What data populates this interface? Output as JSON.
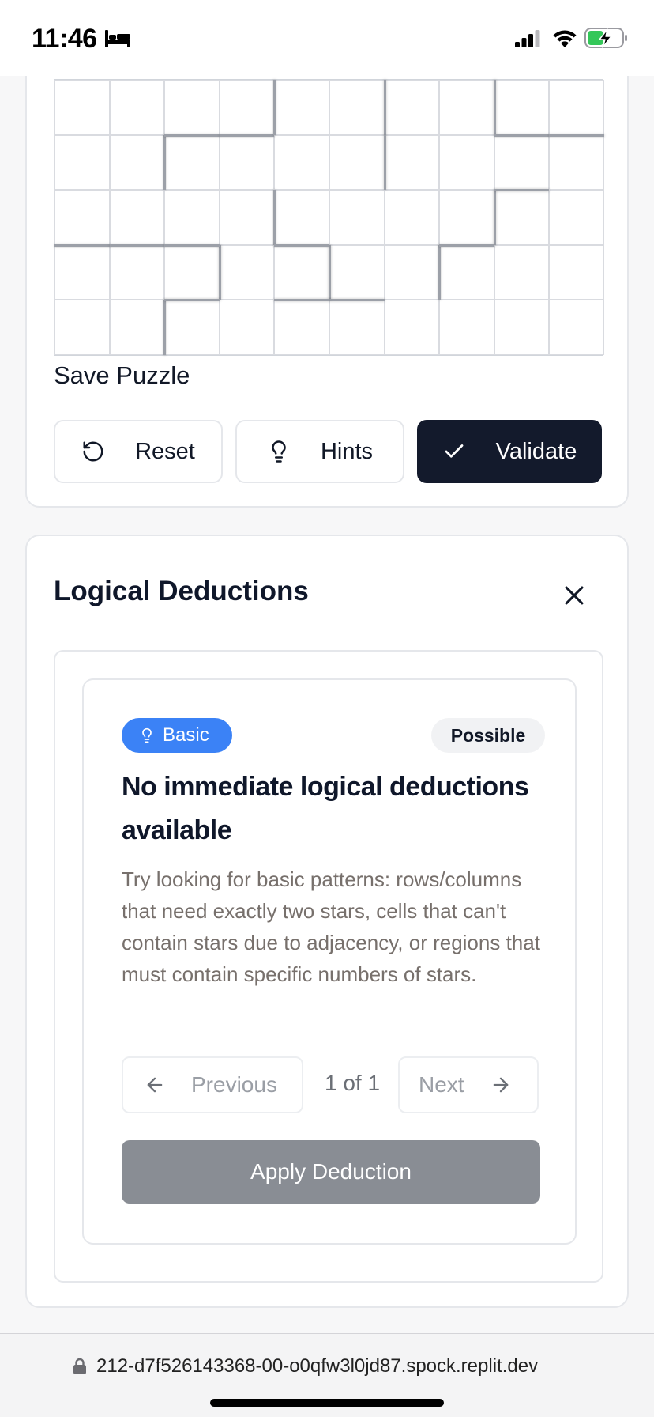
{
  "status_bar": {
    "time": "11:46",
    "icons": [
      "bed-icon",
      "signal-icon",
      "wifi-icon",
      "battery-charging-icon"
    ]
  },
  "puzzle": {
    "grid_columns": 10,
    "grid_visible_rows": 5,
    "save_label": "Save Puzzle",
    "buttons": {
      "reset": "Reset",
      "hints": "Hints",
      "validate": "Validate"
    }
  },
  "deductions": {
    "title": "Logical Deductions",
    "badge_level": "Basic",
    "badge_status": "Possible",
    "heading": "No immediate logical deductions available",
    "description": "Try looking for basic patterns: rows/columns that need exactly two stars, cells that can't contain stars due to adjacency, or regions that must contain specific numbers of stars.",
    "pager": {
      "previous": "Previous",
      "count": "1 of 1",
      "next": "Next"
    },
    "apply_label": "Apply Deduction"
  },
  "browser": {
    "url": "212-d7f526143368-00-o0qfw3l0jd87.spock.replit.dev"
  },
  "colors": {
    "primary_dark": "#131a2c",
    "badge_blue": "#3b82f6",
    "apply_disabled": "#898d94"
  }
}
